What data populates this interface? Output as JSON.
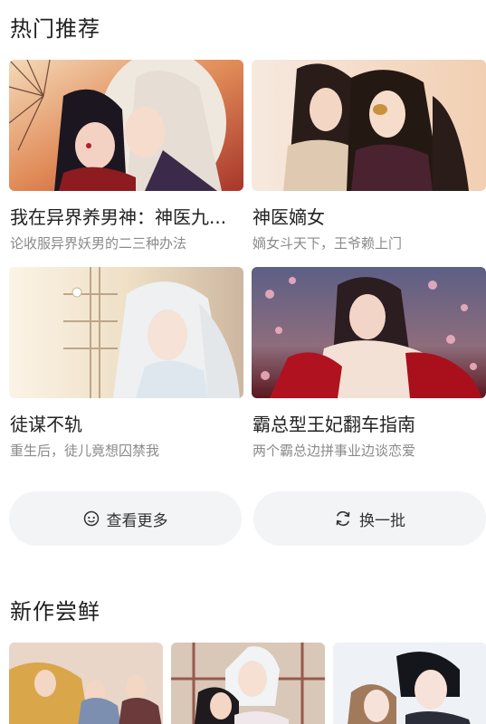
{
  "sections": {
    "hot": {
      "title": "热门推荐",
      "items": [
        {
          "title": "我在异界养男神：神医九...",
          "subtitle": "论收服异界妖男的二三种办法"
        },
        {
          "title": "神医嫡女",
          "subtitle": "嫡女斗天下，王爷赖上门"
        },
        {
          "title": "徒谋不轨",
          "subtitle": "重生后，徒儿竟想囚禁我"
        },
        {
          "title": "霸总型王妃翻车指南",
          "subtitle": "两个霸总边拼事业边谈恋爱"
        }
      ]
    },
    "new": {
      "title": "新作尝鲜"
    }
  },
  "actions": {
    "more_label": "查看更多",
    "refresh_label": "换一批",
    "more_icon": "smile-icon",
    "refresh_icon": "refresh-icon"
  },
  "colors": {
    "button_bg": "#f3f4f6",
    "subtitle": "#8a8a8a"
  }
}
